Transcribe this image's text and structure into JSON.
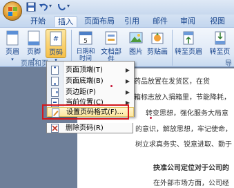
{
  "tabs": [
    "开始",
    "插入",
    "页面布局",
    "引用",
    "邮件",
    "审阅",
    "视图"
  ],
  "ribbon": {
    "buttons": [
      "页眉",
      "页脚",
      "页码",
      "日期和\n时间",
      "文档部件",
      "图片",
      "剪贴画",
      "转至页眉",
      "转至页"
    ],
    "groups": [
      "页眉和页",
      "导"
    ]
  },
  "menu": {
    "items": [
      {
        "label": "页面顶端(T)",
        "submenu": true
      },
      {
        "label": "页面底端(B)",
        "submenu": true
      },
      {
        "label": "页边距(P)",
        "submenu": true
      },
      {
        "label": "当前位置(C)",
        "submenu": true
      },
      {
        "label": "设置页码格式(F)...",
        "submenu": false
      },
      {
        "label": "删除页码(R)",
        "submenu": false
      }
    ]
  },
  "document": {
    "lines": [
      "药品放置在发货区，在货",
      "箱标志放入捐箱里，节能降耗，",
      "转变思想，强化服务大局意",
      "的意识，解放思想，牢记使命，",
      "树立求真务实、锐意进取、勤于",
      "抉准公司定位对于公司的",
      "在外部市场方面，公司经"
    ]
  }
}
